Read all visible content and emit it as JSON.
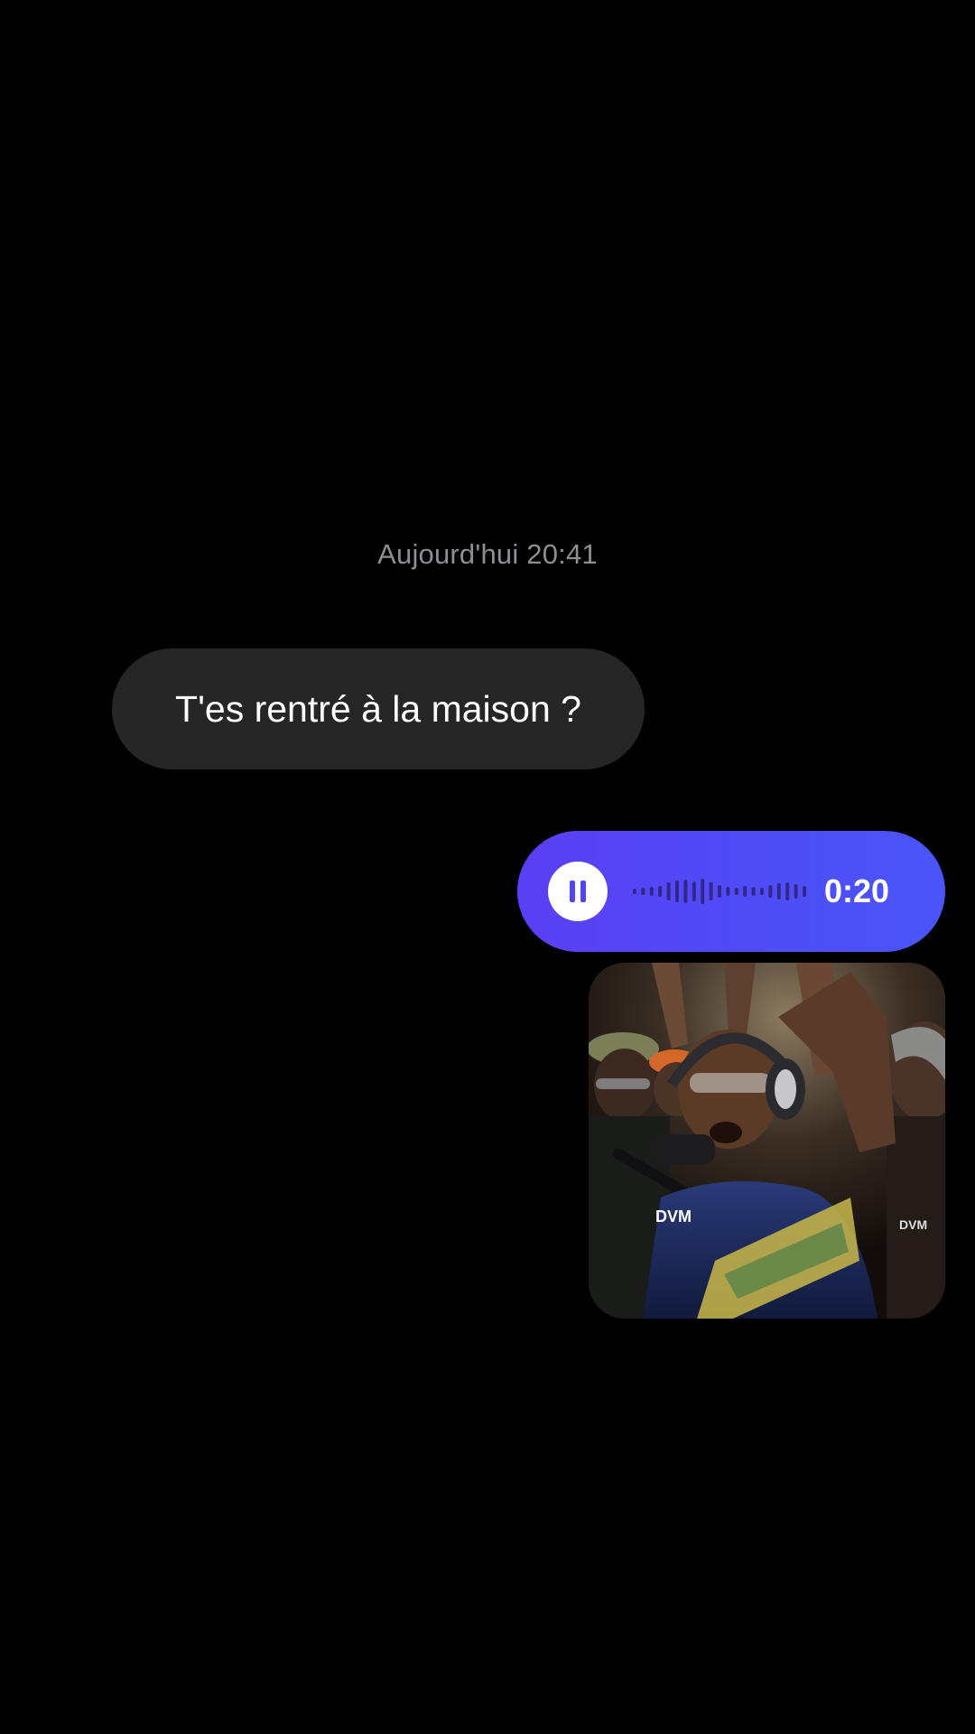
{
  "conversation": {
    "timestamp": "Aujourd'hui 20:41",
    "incoming_message": "T'es rentré à la maison ?",
    "voice_message": {
      "duration": "0:20",
      "state": "playing",
      "progress": 0.0,
      "bubble_color": "#5046f5"
    },
    "media": {
      "watermark_left": "DVM",
      "watermark_right": "DVM"
    }
  },
  "colors": {
    "background": "#000000",
    "incoming_bubble": "#262626",
    "timestamp_text": "#8e8e93",
    "voice_bubble_start": "#5b3ff4",
    "voice_bubble_end": "#4a55f7"
  }
}
